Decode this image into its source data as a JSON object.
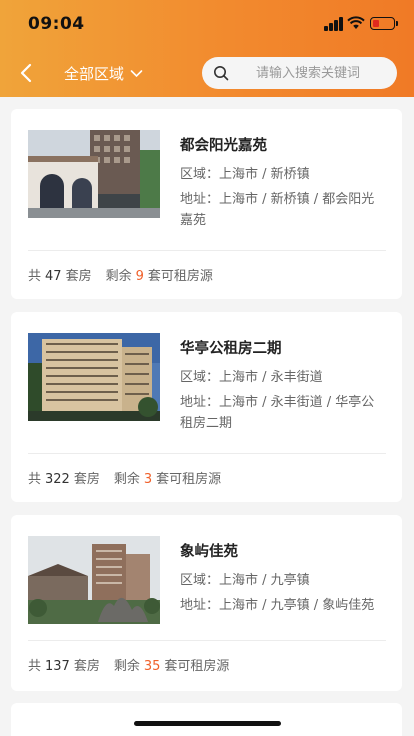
{
  "status_bar": {
    "time": "09:04",
    "battery_color": "#e02a1e"
  },
  "header": {
    "region_label": "全部区域",
    "search_placeholder": "请输入搜索关键词",
    "gradient": [
      "#f0a43a",
      "#f07a26"
    ]
  },
  "listings": [
    {
      "name": "都会阳光嘉苑",
      "area_label": "区域：",
      "area": "上海市 / 新桥镇",
      "address_label": "地址：",
      "address": "上海市 / 新桥镇 / 都会阳光嘉苑",
      "stats_total_prefix": "共",
      "total": "47",
      "stats_total_suffix": "套房",
      "stats_remain_prefix": "剩余",
      "remaining": "9",
      "stats_remain_suffix": "套可租房源"
    },
    {
      "name": "华亭公租房二期",
      "area_label": "区域：",
      "area": "上海市 / 永丰街道",
      "address_label": "地址：",
      "address": "上海市 / 永丰街道 / 华亭公租房二期",
      "stats_total_prefix": "共",
      "total": "322",
      "stats_total_suffix": "套房",
      "stats_remain_prefix": "剩余",
      "remaining": "3",
      "stats_remain_suffix": "套可租房源"
    },
    {
      "name": "象屿佳苑",
      "area_label": "区域：",
      "area": "上海市 / 九亭镇",
      "address_label": "地址：",
      "address": "上海市 / 九亭镇 / 象屿佳苑",
      "stats_total_prefix": "共",
      "total": "137",
      "stats_total_suffix": "套房",
      "stats_remain_prefix": "剩余",
      "remaining": "35",
      "stats_remain_suffix": "套可租房源"
    }
  ],
  "accent_color": "#f0602a"
}
